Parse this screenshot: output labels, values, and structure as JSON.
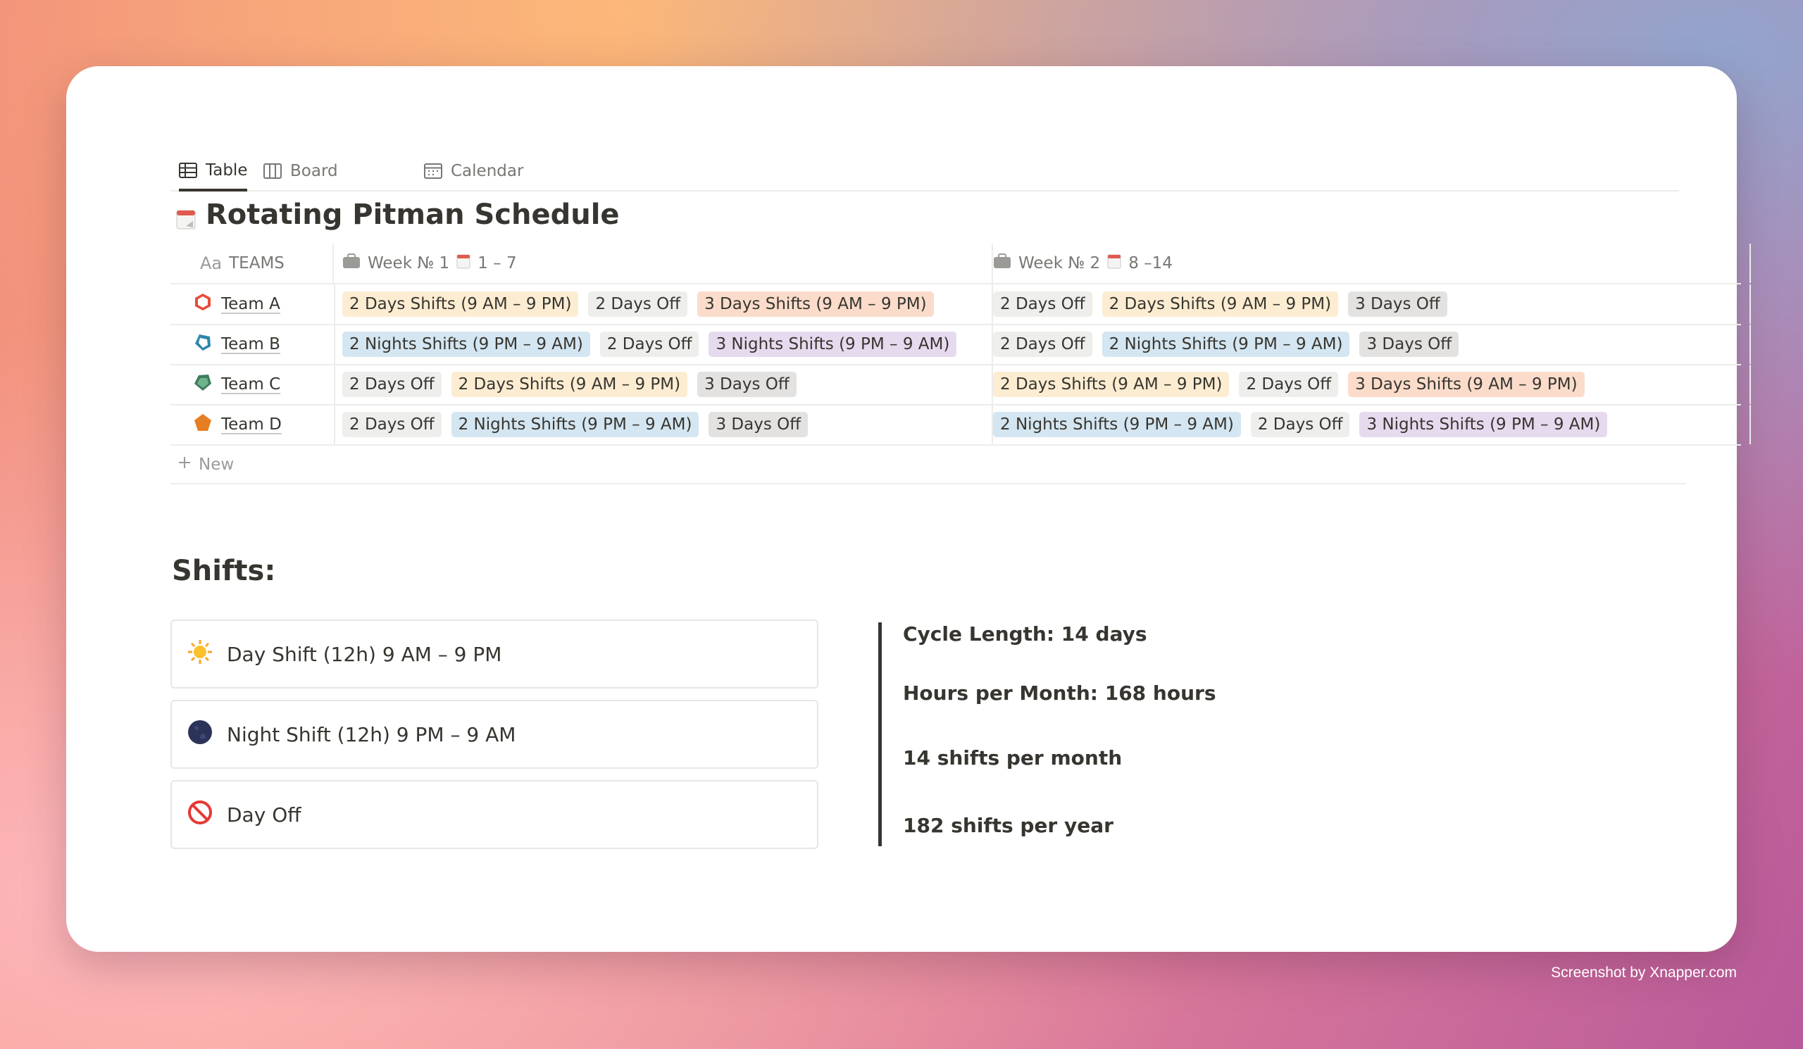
{
  "tabs": [
    {
      "label": "Table",
      "icon": "table-icon",
      "active": true
    },
    {
      "label": "Board",
      "icon": "board-icon",
      "active": false
    },
    {
      "label": "Calendar",
      "icon": "calendar-icon",
      "active": false
    }
  ],
  "page": {
    "title": "Rotating Pitman Schedule",
    "title_icon": "calendar-icon"
  },
  "table": {
    "headers": {
      "teams": {
        "prefix": "Aa",
        "label": "TEAMS"
      },
      "week1": {
        "label": "Week № 1",
        "range": "1 – 7"
      },
      "week2": {
        "label": "Week № 2",
        "range": "8 –14"
      }
    },
    "rows": [
      {
        "team": "Team A",
        "icon": "hexagon-red-icon",
        "week1": [
          "2 Days Shifts (9 AM – 9 PM)",
          "2 Days Off",
          "3 Days Shifts (9 AM – 9 PM)"
        ],
        "week2": [
          "2 Days Off",
          "2 Days Shifts (9 AM – 9 PM)",
          "3 Days Off"
        ]
      },
      {
        "team": "Team B",
        "icon": "shape-blue-icon",
        "week1": [
          "2 Nights Shifts (9 PM – 9 AM)",
          "2 Days Off",
          "3 Nights Shifts (9 PM – 9 AM)"
        ],
        "week2": [
          "2 Days Off",
          "2 Nights Shifts (9 PM – 9 AM)",
          "3 Days Off"
        ]
      },
      {
        "team": "Team C",
        "icon": "shape-green-icon",
        "week1": [
          "2 Days Off",
          "2 Days Shifts (9 AM – 9 PM)",
          "3 Days Off"
        ],
        "week2": [
          "2 Days Shifts (9 AM – 9 PM)",
          "2 Days Off",
          "3 Days Shifts (9 AM – 9 PM)"
        ]
      },
      {
        "team": "Team D",
        "icon": "pentagon-orange-icon",
        "week1": [
          "2 Days Off",
          "2 Nights Shifts (9 PM – 9 AM)",
          "3 Days Off"
        ],
        "week2": [
          "2 Nights Shifts (9 PM – 9 AM)",
          "2 Days Off",
          "3 Nights Shifts (9 PM – 9 AM)"
        ]
      }
    ],
    "new_label": "New"
  },
  "shifts": {
    "heading": "Shifts:",
    "items": [
      {
        "icon": "sun-icon",
        "label": "Day Shift (12h) 9 AM – 9 PM"
      },
      {
        "icon": "moon-icon",
        "label": "Night Shift (12h) 9 PM – 9 AM"
      },
      {
        "icon": "no-entry-icon",
        "label": "Day Off"
      }
    ]
  },
  "stats": {
    "cycle": "Cycle Length: 14 days",
    "hours": "Hours per Month: 168 hours",
    "per_month": "14 shifts per month",
    "per_year": "182 shifts per year"
  },
  "watermark": "Screenshot by Xnapper.com"
}
